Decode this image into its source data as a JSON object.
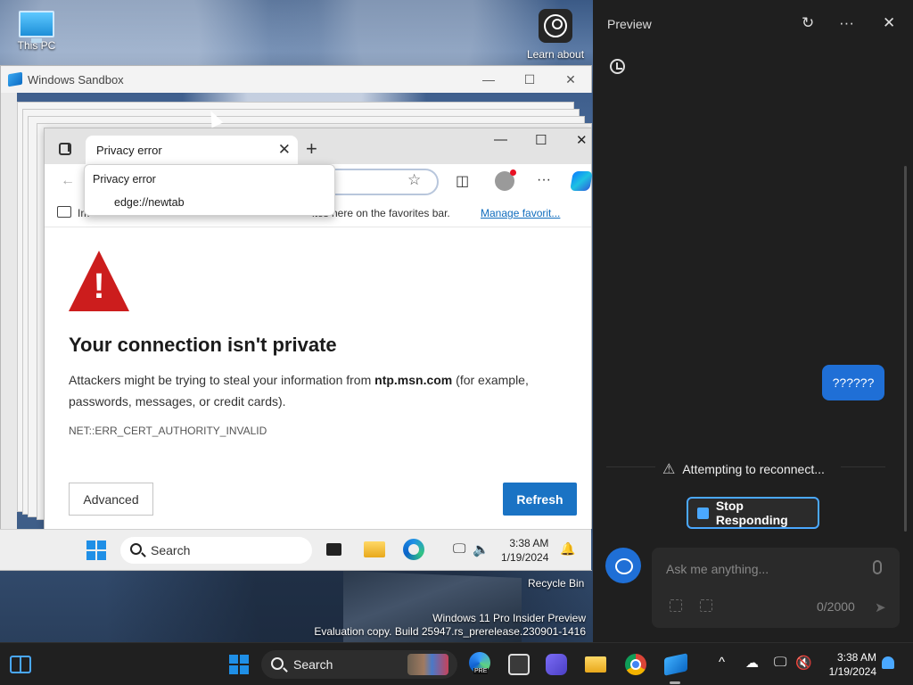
{
  "desktop": {
    "icons": [
      {
        "label": "This PC"
      },
      {
        "label": "Learn about"
      }
    ],
    "recycle_bin": "Recycle Bin",
    "watermark_line1": "Windows 11 Pro Insider Preview",
    "watermark_line2": "Evaluation copy. Build 25947.rs_prerelease.230901-1416"
  },
  "sandbox": {
    "title": "Windows Sandbox",
    "controls": {
      "minimize": "—",
      "maximize": "☐",
      "close": "✕"
    }
  },
  "edge": {
    "tab_title": "Privacy error",
    "tab_close": "✕",
    "new_tab": "+",
    "window_controls": {
      "minimize": "—",
      "maximize": "☐",
      "close": "✕"
    },
    "back": "←",
    "star": "☆",
    "split": "◫",
    "more": "···",
    "dropdown": {
      "item1": "Privacy error",
      "item2": "edge://newtab"
    },
    "favorites": {
      "text_left": "Im",
      "text_right": "ites here on the favorites bar.",
      "manage_link": "Manage favorit..."
    },
    "page": {
      "warning_glyph": "!",
      "headline": "Your connection isn't private",
      "body_prefix": "Attackers might be trying to steal your information from ",
      "body_domain": "ntp.msn.com",
      "body_suffix": " (for example, passwords, messages, or credit cards).",
      "error_code": "NET::ERR_CERT_AUTHORITY_INVALID",
      "advanced_button": "Advanced",
      "refresh_button": "Refresh"
    }
  },
  "inner_taskbar": {
    "search_placeholder": "Search",
    "time": "3:38 AM",
    "date": "1/19/2024",
    "network_glyph": "🖵",
    "volume_glyph": "🔈",
    "bell_glyph": "🔔"
  },
  "taskbar": {
    "search_placeholder": "Search",
    "pre_badge": "PRE",
    "time": "3:38 AM",
    "date": "1/19/2024",
    "chevron": "^",
    "cloud_glyph": "☁",
    "network_glyph": "🖵",
    "volume_glyph": "🔇"
  },
  "preview": {
    "title": "Preview",
    "refresh_icon": "↻",
    "more_icon": "···",
    "close_icon": "✕",
    "user_message": "??????",
    "status": "Attempting to reconnect...",
    "warn_glyph": "⚠",
    "stop_button": "Stop Responding",
    "input_placeholder": "Ask me anything...",
    "char_counter": "0/2000",
    "send_glyph": "➤"
  },
  "colors": {
    "accent": "#1f6fd6",
    "refresh_button": "#1a73c4",
    "warning_red": "#cc1d1d",
    "panel_bg": "#1f1f1f",
    "taskbar_bg": "#202020"
  }
}
